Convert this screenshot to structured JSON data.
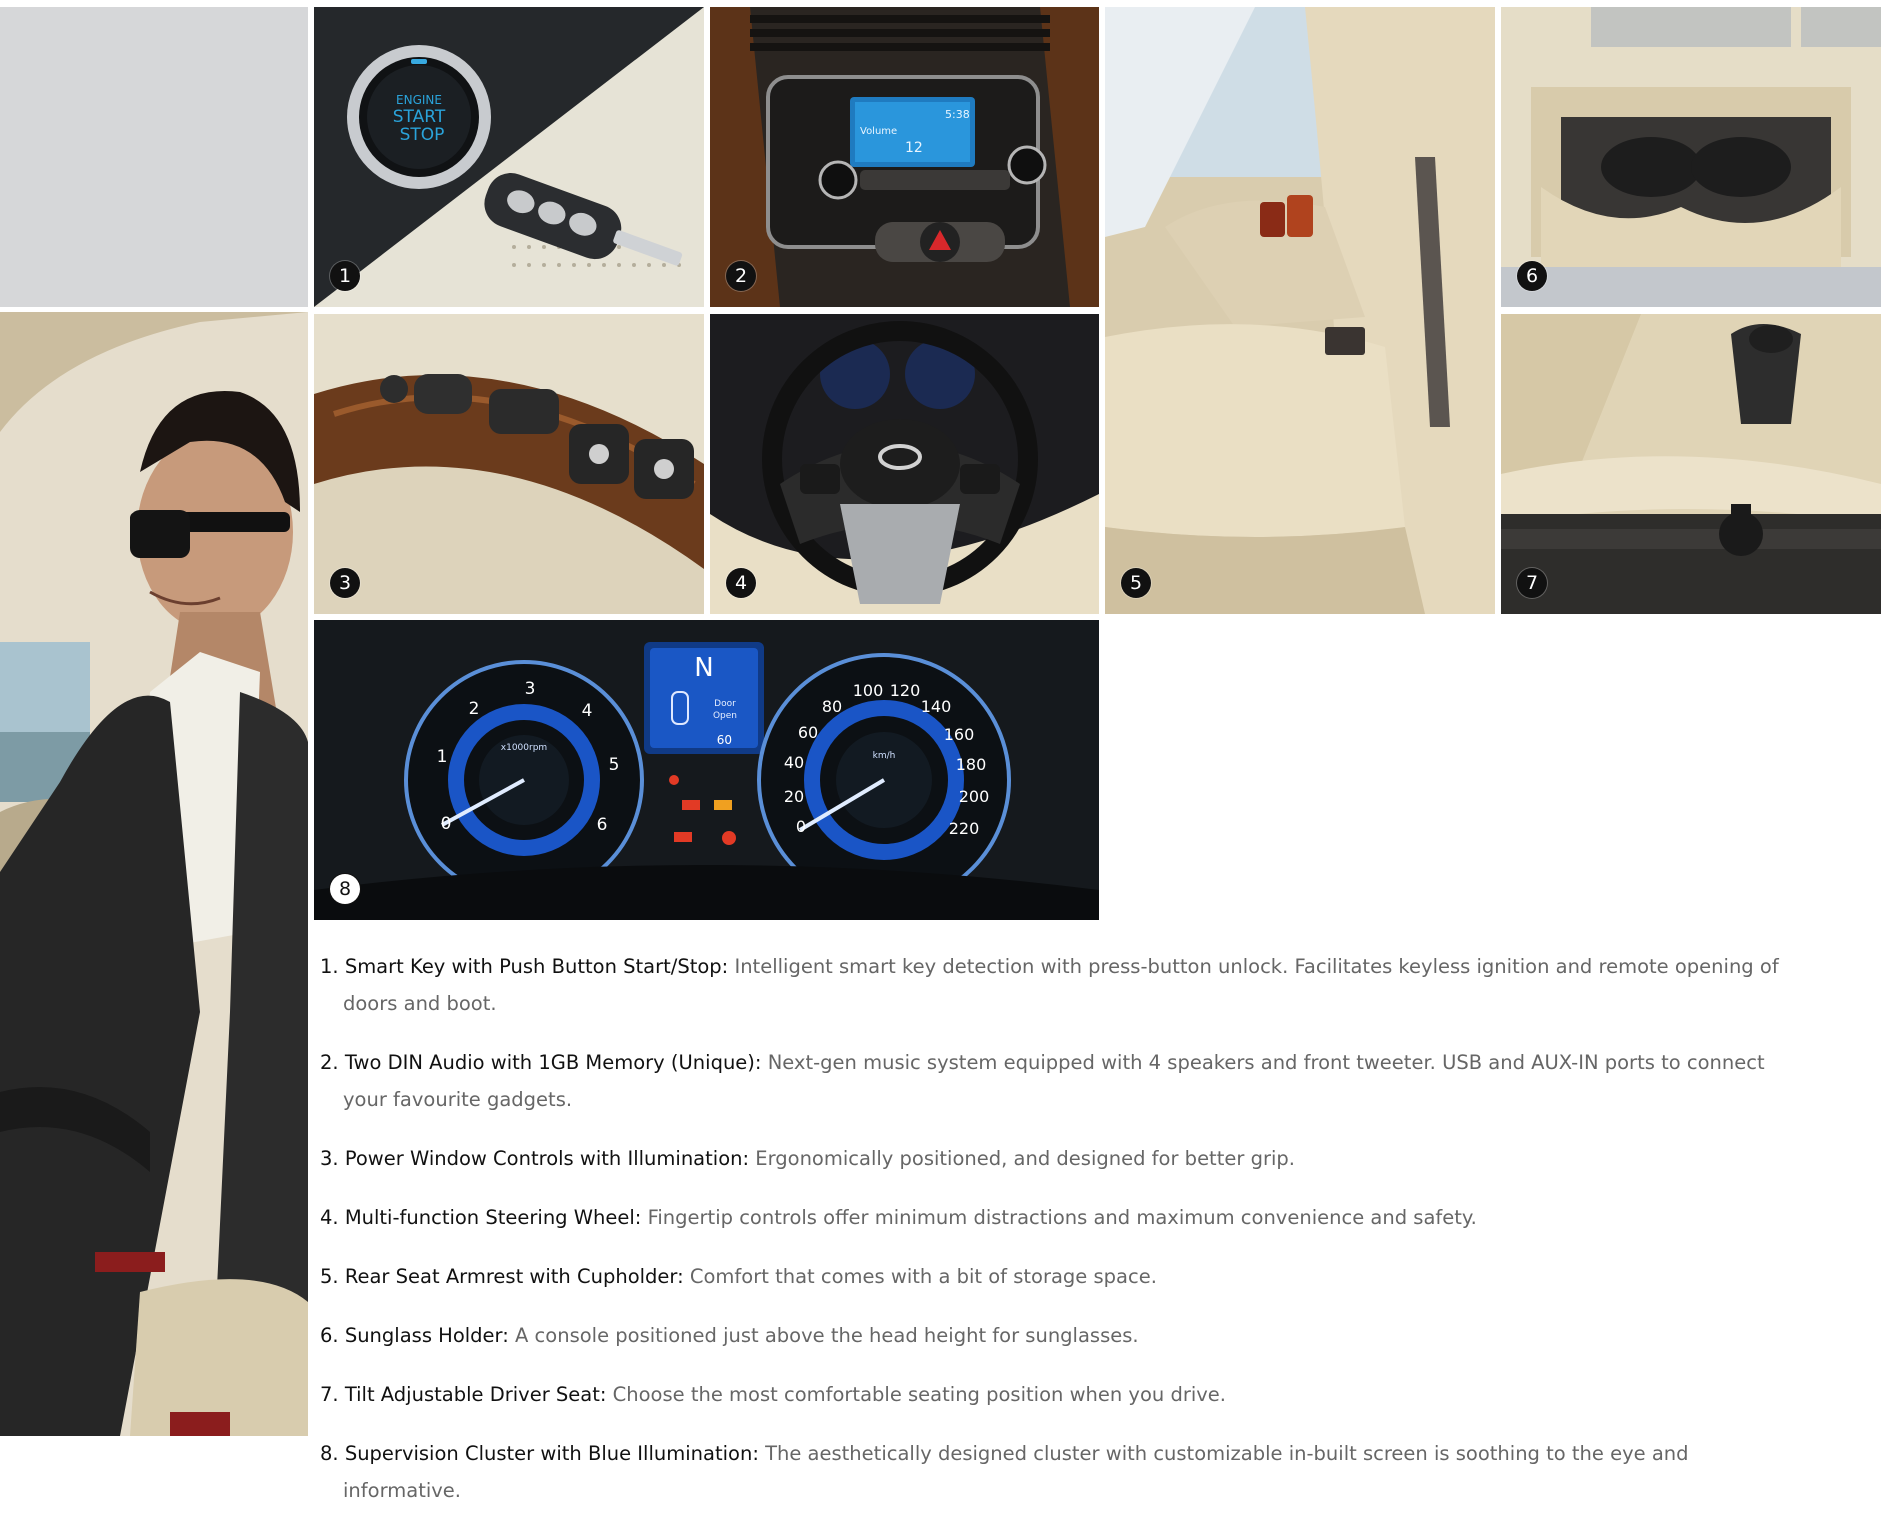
{
  "tiles": [
    {
      "badge": "1",
      "subject": "smart key and push button start/stop"
    },
    {
      "badge": "2",
      "subject": "two DIN audio system"
    },
    {
      "badge": "3",
      "subject": "power window controls"
    },
    {
      "badge": "4",
      "subject": "multi-function steering wheel"
    },
    {
      "badge": "5",
      "subject": "rear seat armrest with cupholder"
    },
    {
      "badge": "6",
      "subject": "sunglass holder"
    },
    {
      "badge": "7",
      "subject": "tilt adjustable driver seat"
    },
    {
      "badge": "8",
      "subject": "supervision cluster"
    }
  ],
  "tile1": {
    "button_text": [
      "ENGINE",
      "START",
      "STOP"
    ]
  },
  "tile2": {
    "screen_line1": "5:38",
    "screen_line2": "Volume",
    "screen_volume": "12"
  },
  "tile8": {
    "gear": "N",
    "door_text": [
      "Door",
      "Open"
    ],
    "speed_readout": "60",
    "tach_unit": "x1000rpm",
    "speed_unit": "km/h",
    "tach_ticks": [
      "0",
      "1",
      "2",
      "3",
      "4",
      "5",
      "6"
    ],
    "speed_ticks": [
      "0",
      "20",
      "40",
      "60",
      "80",
      "100",
      "120",
      "140",
      "160",
      "180",
      "200",
      "220"
    ]
  },
  "features": [
    {
      "num": "1.",
      "title": "Smart Key with Push Button Start/Stop:",
      "desc": "Intelligent smart key detection with press-button unlock. Facilitates keyless ignition and remote opening of doors and boot."
    },
    {
      "num": "2.",
      "title": "Two DIN Audio with 1GB Memory (Unique):",
      "desc": "Next-gen music system equipped with 4 speakers and front tweeter. USB and AUX-IN ports to connect your favourite gadgets."
    },
    {
      "num": "3.",
      "title": "Power Window Controls with Illumination:",
      "desc": "Ergonomically positioned, and designed for better grip."
    },
    {
      "num": "4.",
      "title": "Multi-function Steering Wheel:",
      "desc": "Fingertip controls offer minimum distractions and maximum convenience and safety."
    },
    {
      "num": "5.",
      "title": "Rear Seat Armrest with Cupholder:",
      "desc": "Comfort that comes with a bit of storage space."
    },
    {
      "num": "6.",
      "title": "Sunglass Holder:",
      "desc": "A console positioned just above the head height for sunglasses."
    },
    {
      "num": "7.",
      "title": "Tilt Adjustable Driver Seat:",
      "desc": "Choose the most comfortable seating position when you drive."
    },
    {
      "num": "8.",
      "title": "Supervision Cluster with Blue Illumination:",
      "desc": "The aesthetically designed cluster with customizable in-built screen is soothing to the eye and informative."
    }
  ]
}
